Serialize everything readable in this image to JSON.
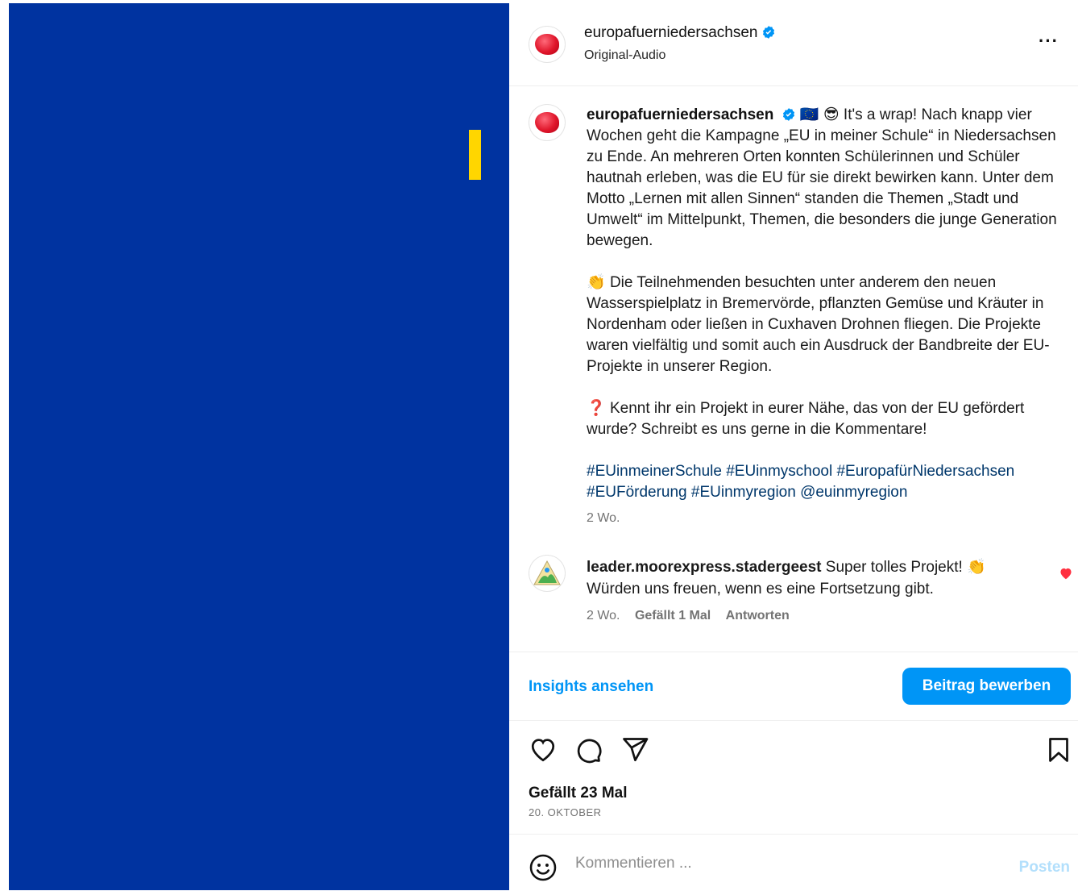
{
  "post": {
    "username": "europafuerniedersachsen",
    "audio": "Original-Audio",
    "caption_emoji_flag": "🇪🇺",
    "caption_emoji_cool": "😎",
    "caption_p1": "It's a wrap! Nach knapp vier Wochen geht die Kampagne „EU in meiner Schule“ in Niedersachsen zu Ende. An mehreren Orten konnten Schülerinnen und Schüler hautnah erleben, was die EU für sie direkt bewirken kann. Unter dem Motto „Lernen mit allen Sinnen“ standen die Themen „Stadt und Umwelt“ im Mittelpunkt, Themen, die besonders die junge Generation bewegen.",
    "caption_p2_emoji": "👏",
    "caption_p2": "Die Teilnehmenden besuchten unter anderem den neuen Wasserspielplatz in Bremervörde, pflanzten Gemüse und Kräuter in Nordenham oder ließen in Cuxhaven Drohnen fliegen. Die Projekte waren vielfältig und somit auch ein Ausdruck der Bandbreite der EU-Projekte in unserer Region.",
    "caption_p3_emoji": "❓",
    "caption_p3": "Kennt ihr ein Projekt in eurer Nähe, das von der EU gefördert wurde? Schreibt es uns gerne in die Kommentare!",
    "hashtags_line1": "#EUinmeinerSchule #EUinmyschool #EuropafürNiedersachsen",
    "hashtags_line2": "#EUFörderung #EUinmyregion @euinmyregion",
    "time": "2 Wo."
  },
  "comment": {
    "username": "leader.moorexpress.stadergeest",
    "text": "Super tolles Projekt!",
    "emoji": "👏",
    "text2": "Würden uns freuen, wenn es eine Fortsetzung gibt.",
    "time": "2 Wo.",
    "likes": "Gefällt 1 Mal",
    "reply": "Antworten"
  },
  "actions": {
    "insights": "Insights ansehen",
    "promote": "Beitrag bewerben",
    "likes": "Gefällt 23 Mal",
    "date": "20. OKTOBER"
  },
  "comment_box": {
    "placeholder": "Kommentieren ...",
    "post": "Posten"
  },
  "colors": {
    "media_bg": "#0033a0",
    "accent_yellow": "#ffd600",
    "link_blue": "#0095f6",
    "hashtag_blue": "#00376b"
  }
}
